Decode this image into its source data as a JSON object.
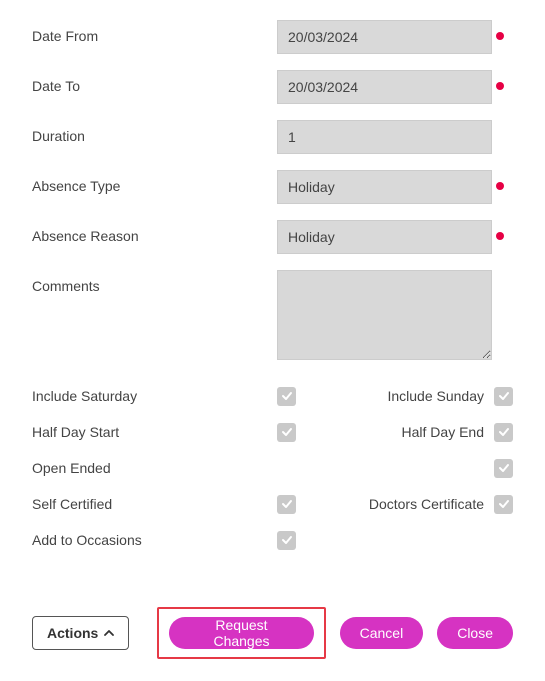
{
  "labels": {
    "date_from": "Date From",
    "date_to": "Date To",
    "duration": "Duration",
    "absence_type": "Absence Type",
    "absence_reason": "Absence Reason",
    "comments": "Comments",
    "include_saturday": "Include Saturday",
    "include_sunday": "Include Sunday",
    "half_day_start": "Half Day Start",
    "half_day_end": "Half Day End",
    "open_ended": "Open Ended",
    "self_certified": "Self Certified",
    "doctors_certificate": "Doctors Certificate",
    "add_to_occasions": "Add to Occasions"
  },
  "fields": {
    "date_from": "20/03/2024",
    "date_to": "20/03/2024",
    "duration": "1",
    "absence_type": "Holiday",
    "absence_reason": "Holiday",
    "comments": ""
  },
  "checkboxes": {
    "include_saturday": true,
    "include_sunday": true,
    "half_day_start": true,
    "half_day_end": true,
    "open_ended": true,
    "self_certified": true,
    "doctors_certificate": true,
    "add_to_occasions": true
  },
  "buttons": {
    "actions": "Actions",
    "request_changes": "Request Changes",
    "cancel": "Cancel",
    "close": "Close"
  }
}
